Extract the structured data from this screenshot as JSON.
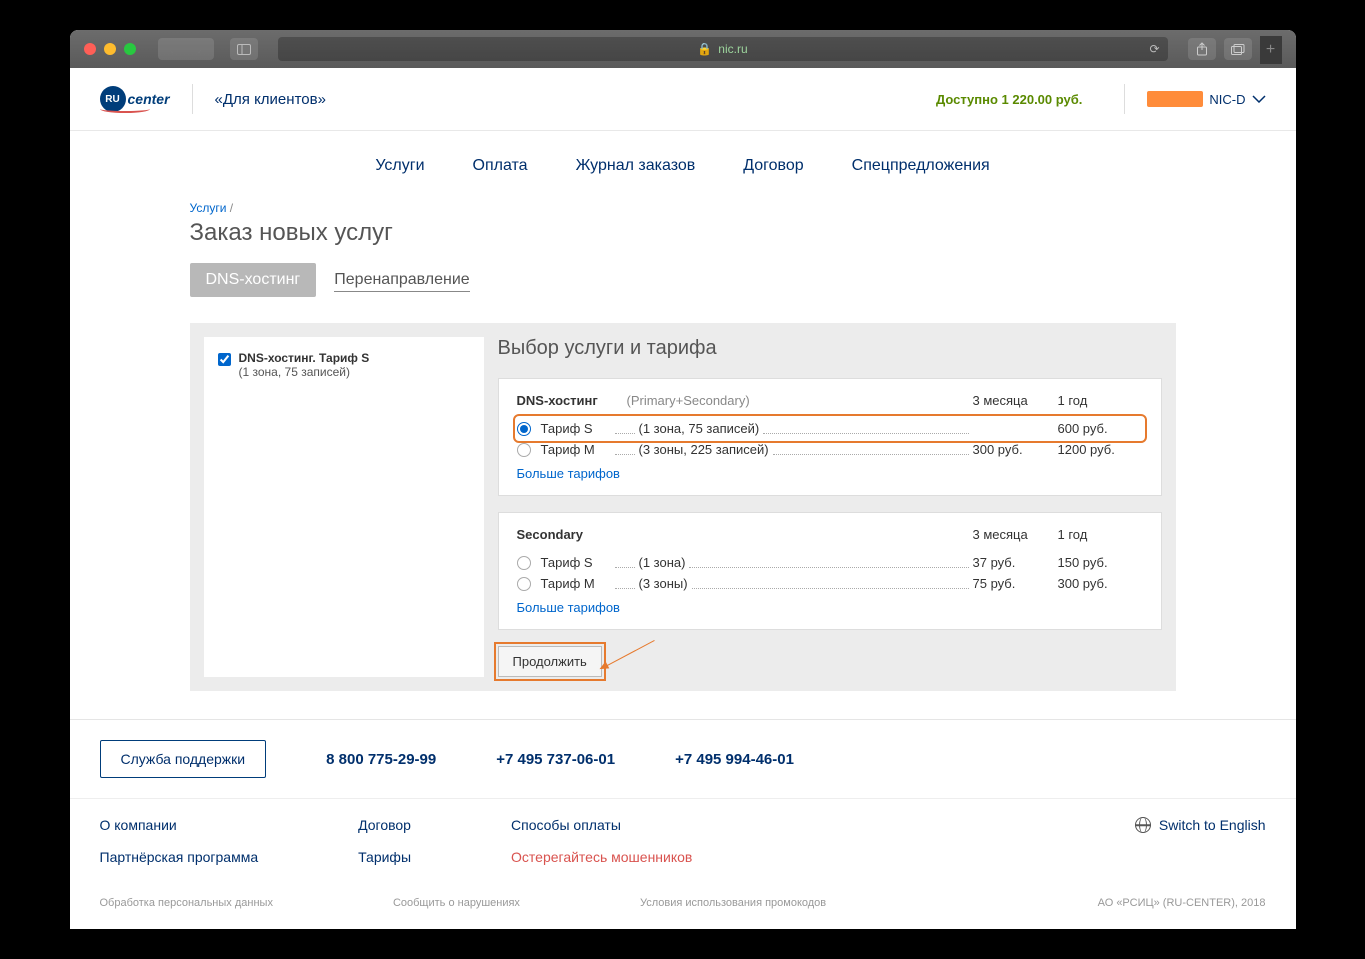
{
  "chrome": {
    "url_host": "nic.ru"
  },
  "header": {
    "logo_badge": "RU",
    "logo_text": "center",
    "client_label": "«Для клиентов»",
    "balance": "Доступно 1 220.00 руб.",
    "account_suffix": "NIC-D"
  },
  "nav": [
    "Услуги",
    "Оплата",
    "Журнал заказов",
    "Договор",
    "Спецпредложения"
  ],
  "breadcrumb": {
    "link": "Услуги",
    "sep": "/"
  },
  "page_title": "Заказ новых услуг",
  "tabs": {
    "active": "DNS-хостинг",
    "inactive": "Перенаправление"
  },
  "cart": {
    "item_title": "DNS-хостинг. Тариф S",
    "item_sub": "(1 зона, 75 записей)"
  },
  "main": {
    "heading": "Выбор услуги и тарифа",
    "more_label": "Больше тарифов",
    "continue_label": "Продолжить",
    "blocks": [
      {
        "name": "DNS-хостинг",
        "sub": "(Primary+Secondary)",
        "col1": "3 месяца",
        "col2": "1 год",
        "rows": [
          {
            "tariff": "Тариф S",
            "desc": "(1 зона, 75 записей)",
            "p1": "",
            "p2": "600 руб.",
            "selected": true,
            "highlight": true
          },
          {
            "tariff": "Тариф M",
            "desc": "(3 зоны, 225 записей)",
            "p1": "300 руб.",
            "p2": "1200 руб.",
            "selected": false,
            "highlight": false
          }
        ]
      },
      {
        "name": "Secondary",
        "sub": "",
        "col1": "3 месяца",
        "col2": "1 год",
        "rows": [
          {
            "tariff": "Тариф S",
            "desc": "(1 зона)",
            "p1": "37 руб.",
            "p2": "150 руб.",
            "selected": false,
            "highlight": false
          },
          {
            "tariff": "Тариф M",
            "desc": "(3 зоны)",
            "p1": "75 руб.",
            "p2": "300 руб.",
            "selected": false,
            "highlight": false
          }
        ]
      }
    ]
  },
  "support": {
    "button": "Служба поддержки",
    "phones": [
      "8 800 775-29-99",
      "+7 495 737-06-01",
      "+7 495 994-46-01"
    ]
  },
  "footer": {
    "col1": [
      "О компании",
      "Партнёрская программа"
    ],
    "col2": [
      "Договор",
      "Тарифы"
    ],
    "col3": [
      {
        "text": "Способы оплаты",
        "warn": false
      },
      {
        "text": "Остерегайтесь мошенников",
        "warn": true
      }
    ],
    "lang": "Switch to English"
  },
  "legal": {
    "links": [
      "Обработка персональных данных",
      "Сообщить о нарушениях",
      "Условия использования промокодов"
    ],
    "copyright": "АО «РСИЦ» (RU-CENTER), 2018"
  }
}
